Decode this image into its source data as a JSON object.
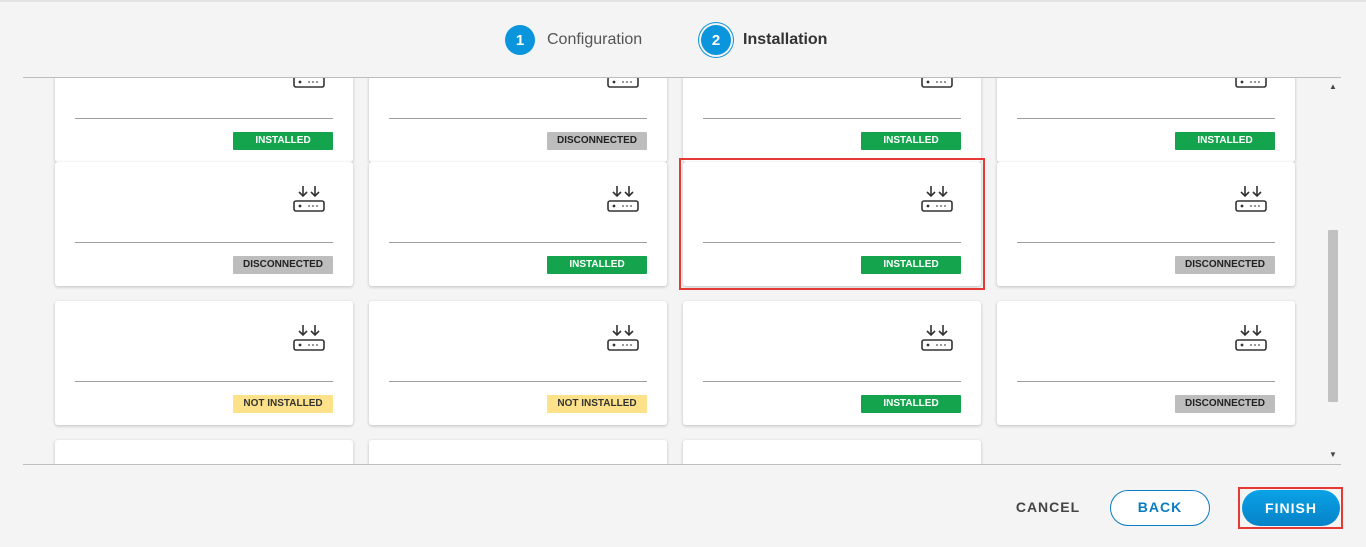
{
  "stepper": {
    "steps": [
      {
        "number": "1",
        "label": "Configuration"
      },
      {
        "number": "2",
        "label": "Installation"
      }
    ]
  },
  "cards": [
    {
      "name": "",
      "status": "INSTALLED",
      "status_type": "installed",
      "icon": "gateway-download-icon"
    },
    {
      "name": "",
      "status": "DISCONNECTED",
      "status_type": "disconnected",
      "icon": "gateway-download-icon"
    },
    {
      "name": "",
      "status": "INSTALLED",
      "status_type": "installed",
      "icon": "gateway-download-icon"
    },
    {
      "name": "",
      "status": "INSTALLED",
      "status_type": "installed",
      "icon": "gateway-download-icon"
    },
    {
      "name": "",
      "status": "DISCONNECTED",
      "status_type": "disconnected",
      "icon": "gateway-download-icon"
    },
    {
      "name": "",
      "status": "INSTALLED",
      "status_type": "installed",
      "icon": "gateway-download-icon"
    },
    {
      "name": "",
      "status": "INSTALLED",
      "status_type": "installed",
      "icon": "gateway-download-icon"
    },
    {
      "name": "",
      "status": "DISCONNECTED",
      "status_type": "disconnected",
      "icon": "gateway-download-icon"
    },
    {
      "name": "",
      "status": "NOT INSTALLED",
      "status_type": "notinstalled",
      "icon": "gateway-download-icon"
    },
    {
      "name": "",
      "status": "NOT INSTALLED",
      "status_type": "notinstalled",
      "icon": "gateway-download-icon"
    },
    {
      "name": "",
      "status": "INSTALLED",
      "status_type": "installed",
      "icon": "gateway-download-icon"
    },
    {
      "name": "",
      "status": "DISCONNECTED",
      "status_type": "disconnected",
      "icon": "gateway-download-icon"
    },
    {
      "name": "",
      "status": "",
      "status_type": "",
      "icon": "gateway-download-icon"
    },
    {
      "name": "",
      "status": "",
      "status_type": "",
      "icon": "gateway-download-icon"
    },
    {
      "name": "",
      "status": "",
      "status_type": "",
      "icon": "gateway-download-icon"
    }
  ],
  "footer": {
    "cancel_label": "CANCEL",
    "back_label": "BACK",
    "finish_label": "FINISH"
  },
  "colors": {
    "accent": "#0a95dc",
    "installed": "#14a44d",
    "disconnected": "#bdbdbd",
    "not_installed": "#fde28a",
    "highlight": "#e53935"
  }
}
